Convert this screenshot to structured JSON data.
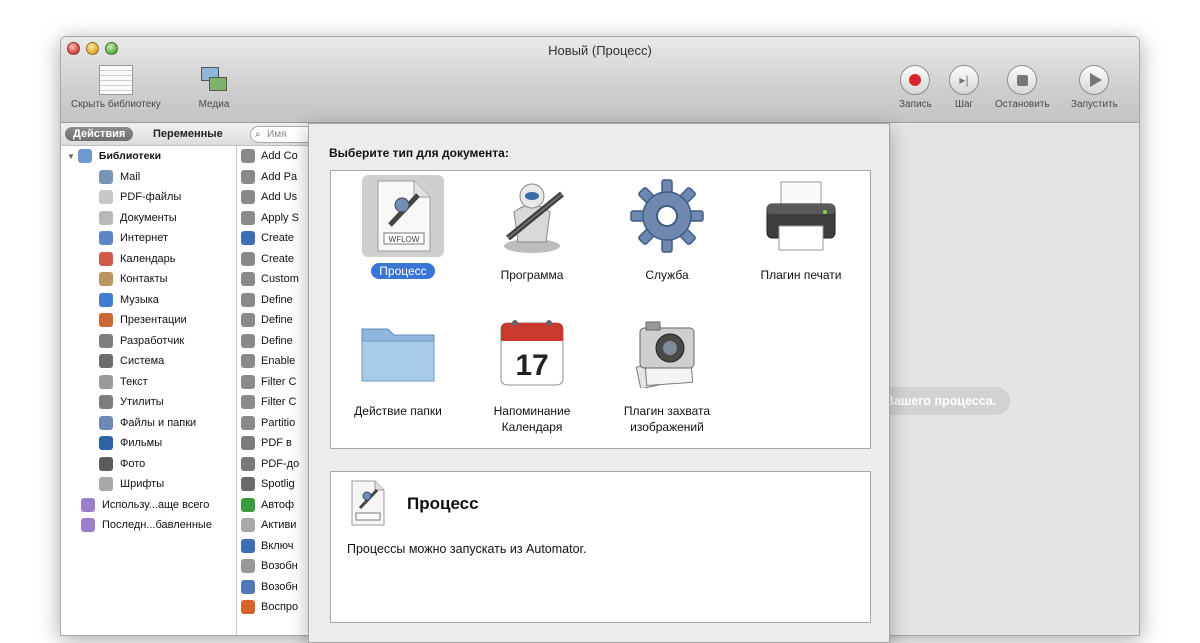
{
  "window": {
    "title": "Новый (Процесс)"
  },
  "toolbar": {
    "hide_library": "Скрыть библиотеку",
    "media": "Медиа",
    "record": "Запись",
    "step": "Шаг",
    "stop": "Остановить",
    "run": "Запустить"
  },
  "library": {
    "tab_actions": "Действия",
    "tab_variables": "Переменные",
    "search_placeholder": "Имя",
    "root": "Библиотеки",
    "categories": [
      {
        "label": "Mail",
        "icon": "mail-icon",
        "color": "#7a94b5"
      },
      {
        "label": "PDF-файлы",
        "icon": "pdf-icon",
        "color": "#c7c7c7"
      },
      {
        "label": "Документы",
        "icon": "documents-icon",
        "color": "#b8b8b8"
      },
      {
        "label": "Интернет",
        "icon": "internet-icon",
        "color": "#5d86c4"
      },
      {
        "label": "Календарь",
        "icon": "calendar-icon",
        "color": "#d25a4a"
      },
      {
        "label": "Контакты",
        "icon": "contacts-icon",
        "color": "#b99560"
      },
      {
        "label": "Музыка",
        "icon": "music-icon",
        "color": "#3f7fcf"
      },
      {
        "label": "Презентации",
        "icon": "presentation-icon",
        "color": "#c96a36"
      },
      {
        "label": "Разработчик",
        "icon": "developer-icon",
        "color": "#7d7d7d"
      },
      {
        "label": "Система",
        "icon": "system-icon",
        "color": "#6d6d6d"
      },
      {
        "label": "Текст",
        "icon": "text-icon",
        "color": "#9a9a9a"
      },
      {
        "label": "Утилиты",
        "icon": "utilities-icon",
        "color": "#7d7d7d"
      },
      {
        "label": "Файлы и папки",
        "icon": "files-icon",
        "color": "#6e89b3"
      },
      {
        "label": "Фильмы",
        "icon": "movies-icon",
        "color": "#2f63a8"
      },
      {
        "label": "Фото",
        "icon": "photo-icon",
        "color": "#5b5b5b"
      },
      {
        "label": "Шрифты",
        "icon": "fonts-icon",
        "color": "#a8a8a8"
      }
    ],
    "smart_groups": [
      {
        "label": "Использу...аще всего",
        "icon": "smart-folder-icon",
        "color": "#9b7fc9"
      },
      {
        "label": "Последн...бавленные",
        "icon": "smart-folder-icon",
        "color": "#9b7fc9"
      }
    ],
    "actions": [
      {
        "label": "Add Co",
        "color": "#8a8a8a"
      },
      {
        "label": "Add Pa",
        "color": "#8a8a8a"
      },
      {
        "label": "Add Us",
        "color": "#8a8a8a"
      },
      {
        "label": "Apply S",
        "color": "#8a8a8a"
      },
      {
        "label": "Create",
        "color": "#3c6fb5"
      },
      {
        "label": "Create",
        "color": "#8a8a8a"
      },
      {
        "label": "Custom",
        "color": "#8a8a8a"
      },
      {
        "label": "Define",
        "color": "#8a8a8a"
      },
      {
        "label": "Define",
        "color": "#8a8a8a"
      },
      {
        "label": "Define",
        "color": "#8a8a8a"
      },
      {
        "label": "Enable",
        "color": "#8a8a8a"
      },
      {
        "label": "Filter C",
        "color": "#8a8a8a"
      },
      {
        "label": "Filter C",
        "color": "#8a8a8a"
      },
      {
        "label": "Partitio",
        "color": "#8a8a8a"
      },
      {
        "label": "PDF в",
        "color": "#7b7b7b"
      },
      {
        "label": "PDF-до",
        "color": "#7b7b7b"
      },
      {
        "label": "Spotlig",
        "color": "#6a6a6a"
      },
      {
        "label": "Автоф",
        "color": "#3b9a3b"
      },
      {
        "label": "Активи",
        "color": "#a9a9a9"
      },
      {
        "label": "Включ",
        "color": "#3c6fb5"
      },
      {
        "label": "Возобн",
        "color": "#9a9a9a"
      },
      {
        "label": "Возобн",
        "color": "#4f78b8"
      },
      {
        "label": "Воспро",
        "color": "#d6632a"
      }
    ]
  },
  "placeholder_hint": "ания Вашего процесса.",
  "chooser": {
    "prompt": "Выберите тип для документа:",
    "types": [
      {
        "label": "Процесс",
        "icon": "workflow-document-icon"
      },
      {
        "label": "Программа",
        "icon": "automator-robot-icon"
      },
      {
        "label": "Служба",
        "icon": "gear-icon"
      },
      {
        "label": "Плагин печати",
        "icon": "printer-icon"
      },
      {
        "label": "Действие папки",
        "icon": "folder-icon"
      },
      {
        "label": "Напоминание Календаря",
        "icon": "calendar-icon"
      },
      {
        "label": "Плагин захвата изображений",
        "icon": "camera-icon"
      }
    ],
    "selected_index": 0,
    "wflow_label": "WFLOW",
    "calendar_day": "17",
    "description": {
      "title": "Процесс",
      "text": "Процессы можно запускать из Automator."
    }
  }
}
